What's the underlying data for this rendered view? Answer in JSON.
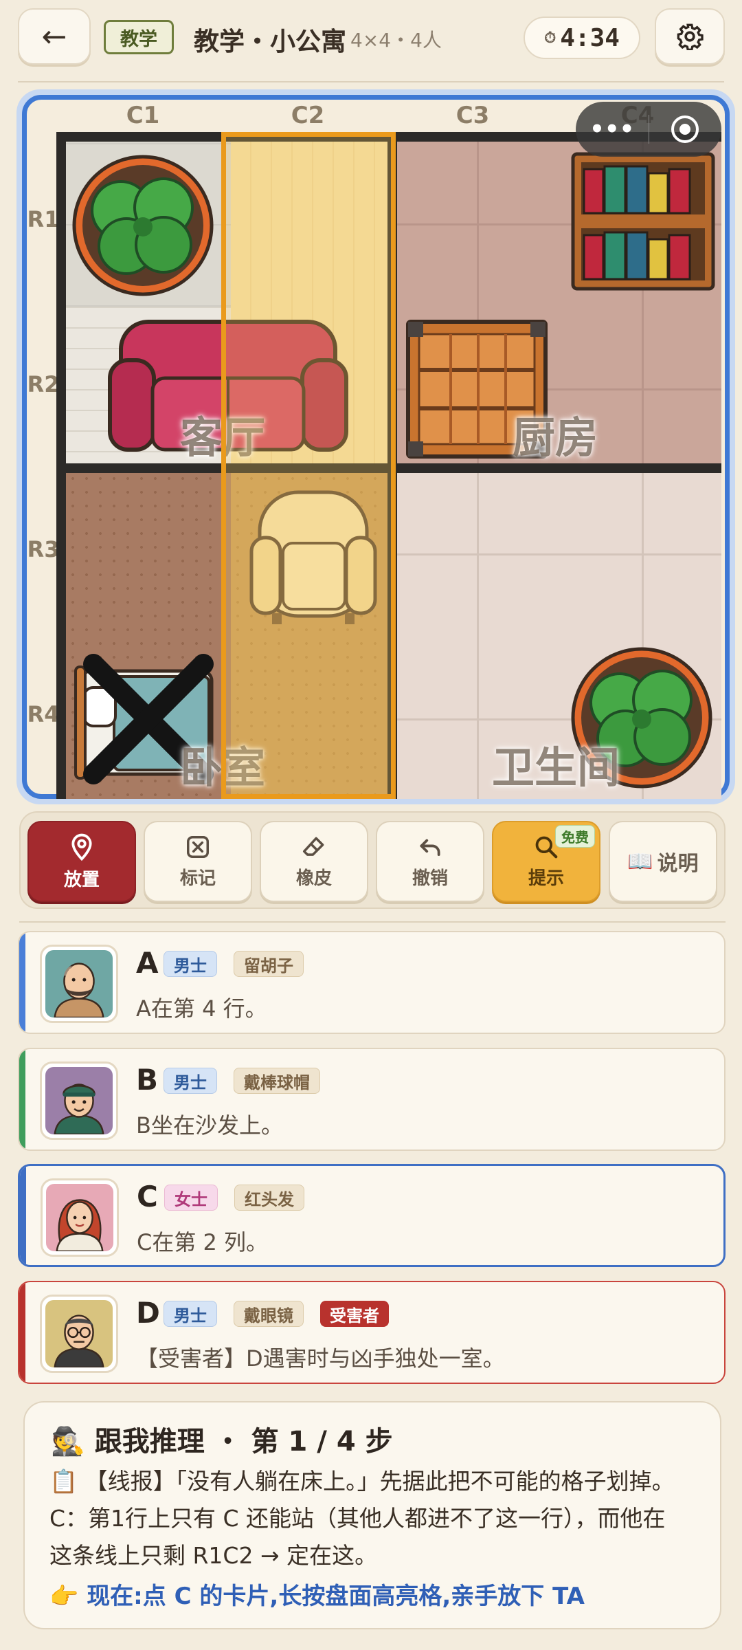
{
  "header": {
    "back_icon": "←",
    "tag": "教学",
    "title": "教学・小公寓",
    "subtitle": "4×4・4人",
    "timer": "4:34"
  },
  "board": {
    "columns": [
      "C1",
      "C2",
      "C3",
      "C4"
    ],
    "rows": [
      "R1",
      "R2",
      "R3",
      "R4"
    ],
    "rooms": {
      "living": "客厅",
      "kitchen": "厨房",
      "bedroom": "卧室",
      "bathroom": "卫生间"
    },
    "highlight_column": "C2",
    "crossed_cell": "R4C1"
  },
  "toolbar": {
    "place": "放置",
    "mark": "标记",
    "eraser": "橡皮",
    "undo": "撤销",
    "hint": "提示",
    "hint_badge": "免费",
    "explain": "说明",
    "explain_icon": "📖"
  },
  "suspects": [
    {
      "name": "A",
      "gender": "男士",
      "attr": "留胡子",
      "desc": "A在第 4 行。",
      "stripe": "#4a7fd8"
    },
    {
      "name": "B",
      "gender": "男士",
      "attr": "戴棒球帽",
      "desc": "B坐在沙发上。",
      "stripe": "#3f9d5c"
    },
    {
      "name": "C",
      "gender": "女士",
      "attr": "红头发",
      "desc": "C在第 2 列。",
      "stripe": "#3f6fc4"
    },
    {
      "name": "D",
      "gender": "男士",
      "attr": "戴眼镜",
      "victim": "受害者",
      "desc": "【受害者】D遇害时与凶手独处一室。",
      "stripe": "#b8322d"
    }
  ],
  "guide": {
    "icon": "🕵",
    "title": "跟我推理 ・ 第 1 / 4 步",
    "clue_icon": "📋",
    "line1": "【线报】「没有人躺在床上。」先据此把不可能的格子划掉。",
    "line2": "C：第1行上只有 C 还能站（其他人都进不了这一行），而他在",
    "line3": "这条线上只剩 R1C2 → 定在这。",
    "action_icon": "👉",
    "action": "现在:点 C 的卡片,长按盘面高亮格,亲手放下 TA"
  }
}
